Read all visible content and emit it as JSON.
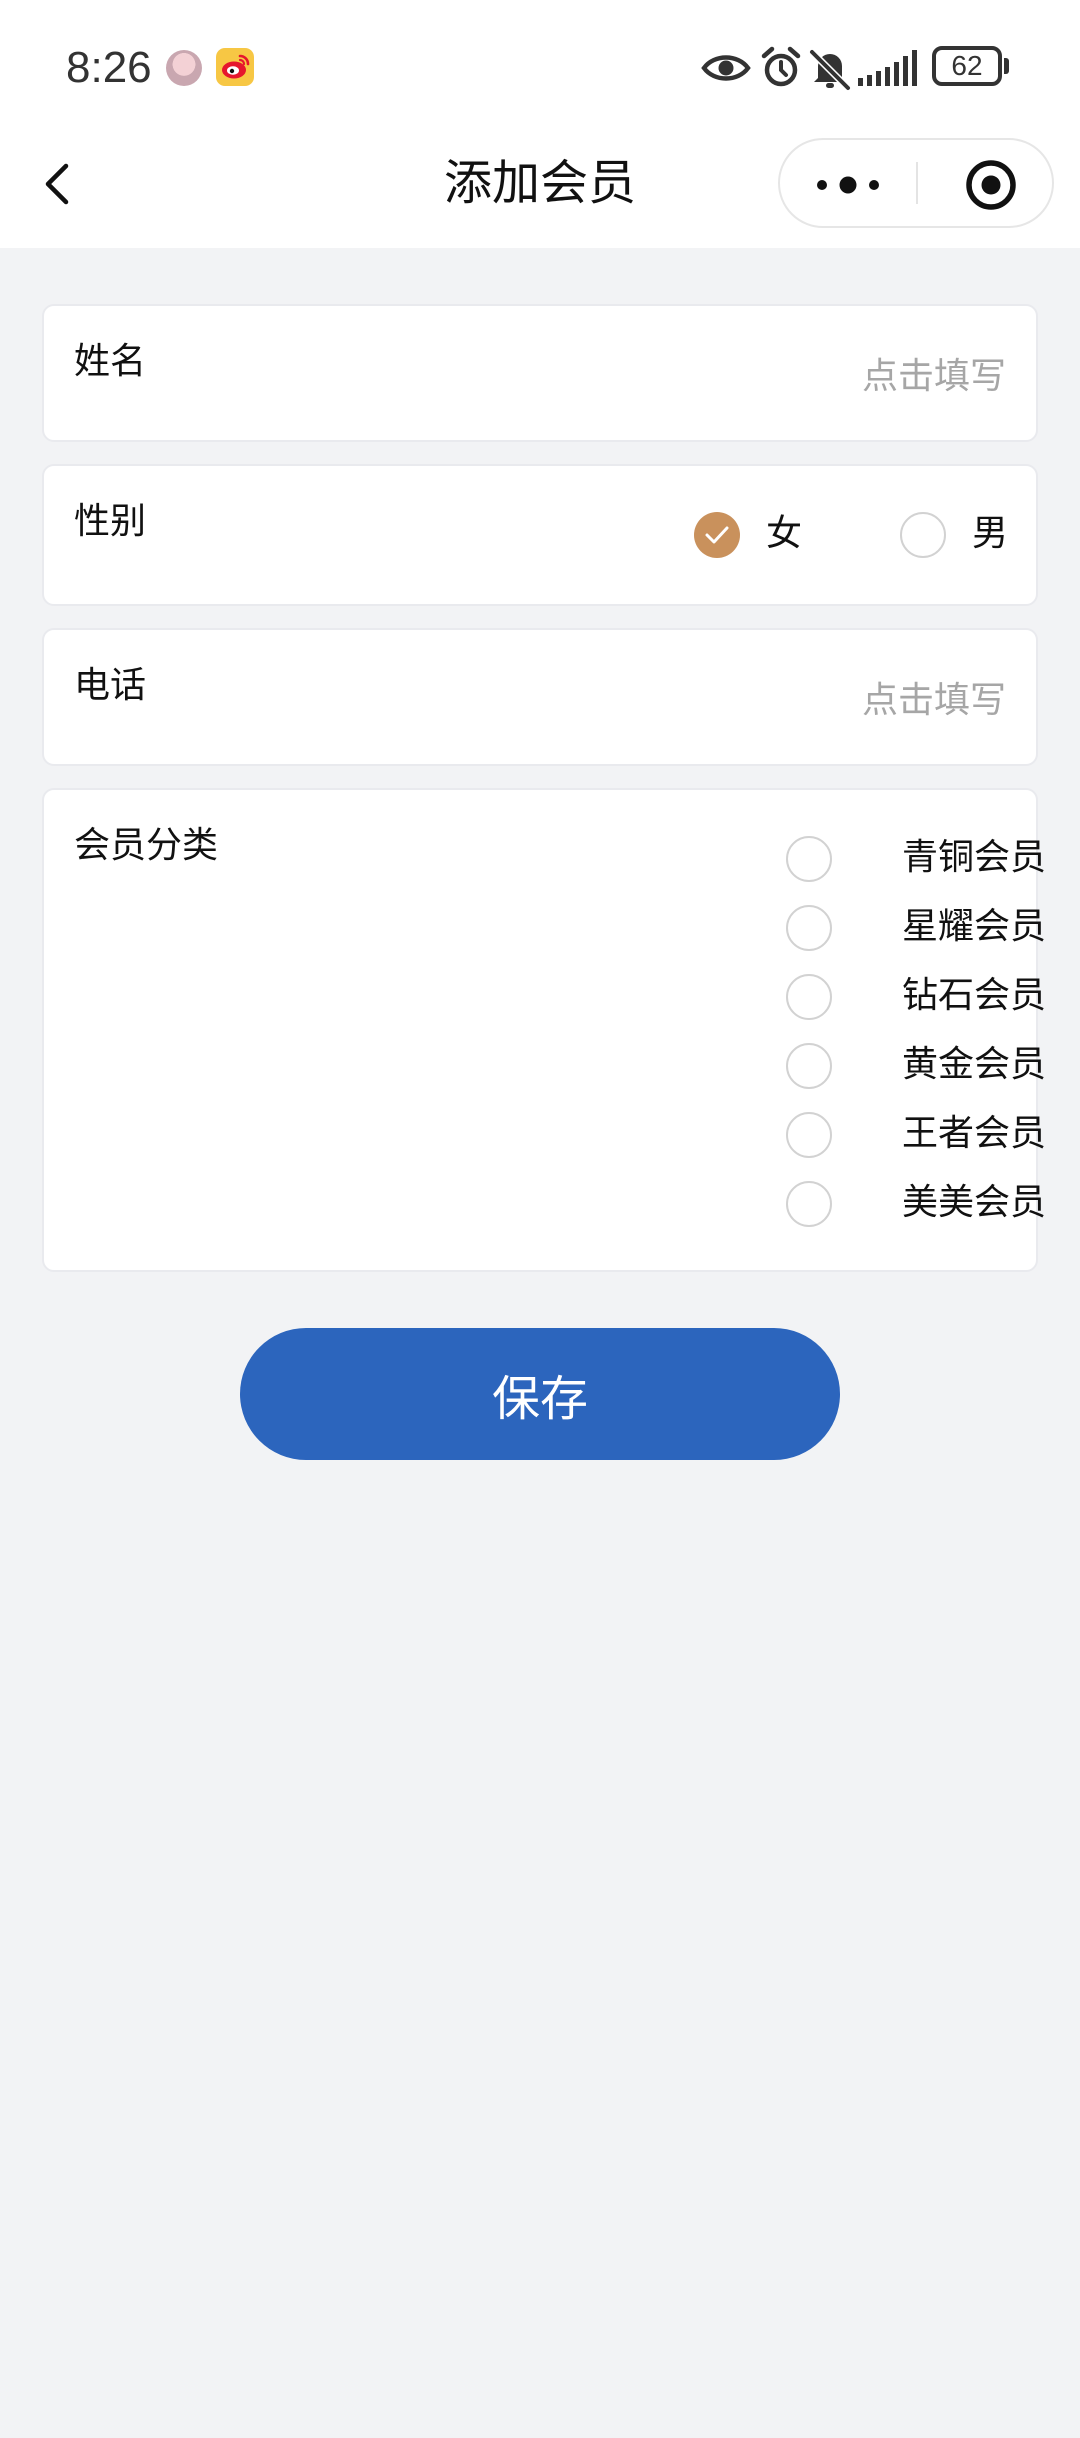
{
  "status_bar": {
    "time": "8:26",
    "battery": "62",
    "icons": [
      "avatar-icon",
      "weibo-icon",
      "eye-icon",
      "alarm-icon",
      "mute-bell-icon",
      "signal-icon",
      "battery-icon"
    ]
  },
  "nav": {
    "title": "添加会员",
    "back_icon": "chevron-left-icon",
    "more_icon": "more-dots-icon",
    "close_icon": "target-close-icon"
  },
  "form": {
    "name": {
      "label": "姓名",
      "value": "",
      "placeholder": "点击填写"
    },
    "gender": {
      "label": "性别",
      "options": [
        {
          "label": "女",
          "checked": true
        },
        {
          "label": "男",
          "checked": false
        }
      ]
    },
    "phone": {
      "label": "电话",
      "value": "",
      "placeholder": "点击填写"
    },
    "category": {
      "label": "会员分类",
      "options": [
        {
          "label": "青铜会员",
          "checked": false
        },
        {
          "label": "星耀会员",
          "checked": false
        },
        {
          "label": "钻石会员",
          "checked": false
        },
        {
          "label": "黄金会员",
          "checked": false
        },
        {
          "label": "王者会员",
          "checked": false
        },
        {
          "label": "美美会员",
          "checked": false
        }
      ]
    }
  },
  "save_button": {
    "label": "保存"
  },
  "colors": {
    "accent_checked": "#c9915c",
    "primary_button": "#2c65bd",
    "page_background": "#f2f3f5",
    "placeholder": "#a6a6a6"
  }
}
